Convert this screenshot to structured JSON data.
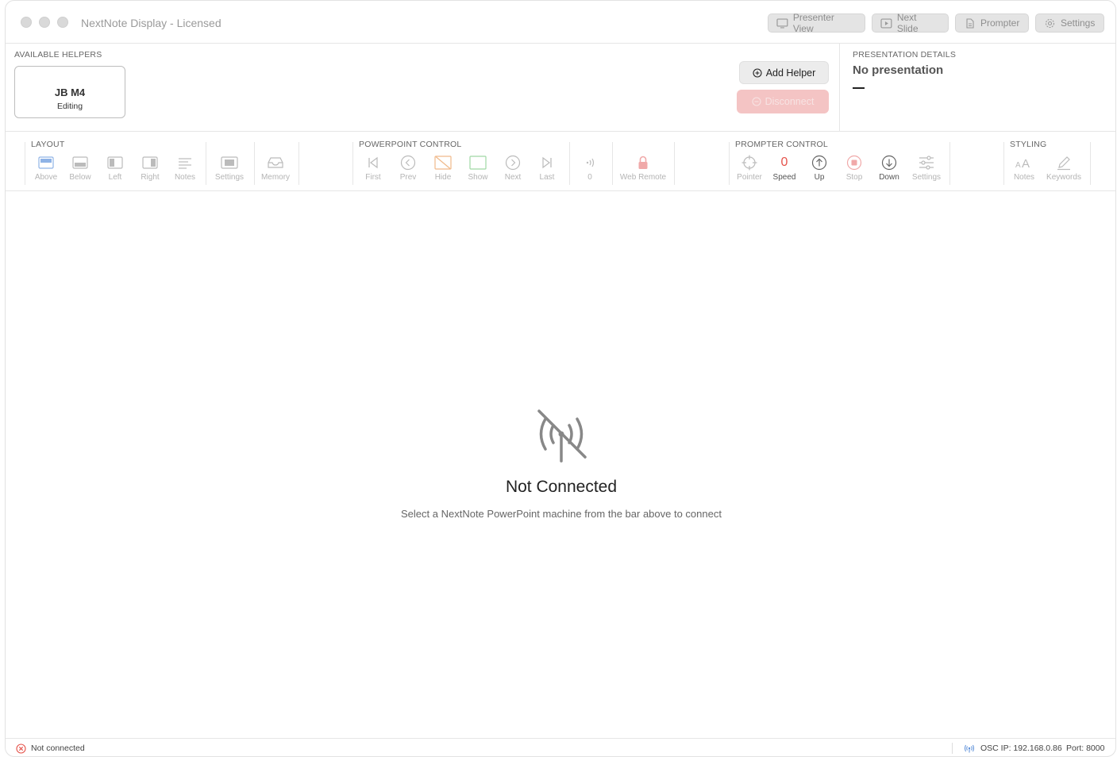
{
  "window": {
    "title": "NextNote Display - Licensed",
    "titlebar_buttons": [
      {
        "label": "Presenter View",
        "icon": "monitor-icon"
      },
      {
        "label": "Next Slide",
        "icon": "play-icon"
      },
      {
        "label": "Prompter",
        "icon": "document-icon"
      },
      {
        "label": "Settings",
        "icon": "gear-icon"
      }
    ]
  },
  "helpers": {
    "section_label": "AVAILABLE HELPERS",
    "items": [
      {
        "name": "JB M4",
        "status": "Editing"
      }
    ],
    "add_label": "Add Helper",
    "disconnect_label": "Disconnect"
  },
  "presentation": {
    "section_label": "PRESENTATION DETAILS",
    "title": "No presentation"
  },
  "toolbar": {
    "layout": {
      "label": "LAYOUT",
      "items": [
        "Above",
        "Below",
        "Left",
        "Right",
        "Notes",
        "Settings",
        "Memory"
      ]
    },
    "powerpoint": {
      "label": "POWERPOINT CONTROL",
      "items": [
        "First",
        "Prev",
        "Hide",
        "Show",
        "Next",
        "Last",
        "0",
        "Web Remote"
      ]
    },
    "prompter": {
      "label": "PROMPTER CONTROL",
      "items": [
        "Pointer",
        "Speed",
        "Up",
        "Stop",
        "Down",
        "Settings"
      ],
      "speed_value": "0"
    },
    "styling": {
      "label": "STYLING",
      "items": [
        "Notes",
        "Keywords"
      ]
    }
  },
  "main": {
    "title": "Not Connected",
    "subtitle": "Select a NextNote PowerPoint machine from the bar above to connect"
  },
  "status": {
    "left": "Not connected",
    "osc_ip": "OSC IP: 192.168.0.86",
    "port": "Port: 8000"
  },
  "colors": {
    "accent_blue": "#5a8ed8",
    "danger_red": "#e5534b",
    "disabled_red": "#f4c4c4"
  }
}
